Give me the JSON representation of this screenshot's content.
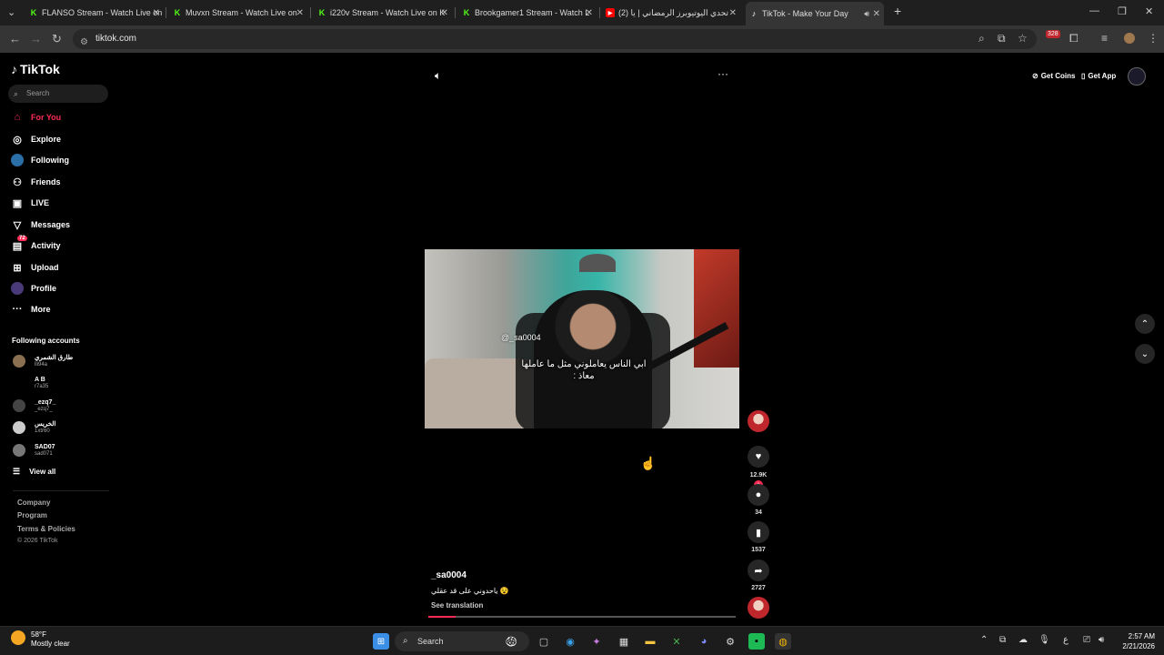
{
  "browser": {
    "tabs": [
      {
        "title": "FLANSO Stream - Watch Live on",
        "icon": "kick-icon",
        "color": "#53fc18"
      },
      {
        "title": "Muvxn Stream - Watch Live on",
        "icon": "kick-icon",
        "color": "#53fc18"
      },
      {
        "title": "i220v Stream - Watch Live on K",
        "icon": "kick-icon",
        "color": "#53fc18"
      },
      {
        "title": "Brookgamer1 Stream - Watch L",
        "icon": "kick-icon",
        "color": "#53fc18"
      },
      {
        "title": "(2) تحدي اليوتيوبرز الرمضاني | يا",
        "icon": "youtube-icon",
        "color": "#ff0000"
      },
      {
        "title": "TikTok - Make Your Day",
        "icon": "tiktok-icon",
        "color": "#ffffff"
      }
    ],
    "url": "tiktok.com",
    "extension_badge": "328"
  },
  "sidebar": {
    "logo": "TikTok",
    "search_placeholder": "Search",
    "nav": [
      {
        "label": "For You",
        "icon": "home-icon",
        "active": true
      },
      {
        "label": "Explore",
        "icon": "compass-icon"
      },
      {
        "label": "Following",
        "icon": "following-icon"
      },
      {
        "label": "Friends",
        "icon": "friends-icon"
      },
      {
        "label": "LIVE",
        "icon": "live-icon"
      },
      {
        "label": "Messages",
        "icon": "messages-icon"
      },
      {
        "label": "Activity",
        "icon": "activity-icon",
        "badge": "72"
      },
      {
        "label": "Upload",
        "icon": "upload-icon"
      },
      {
        "label": "Profile",
        "icon": "profile-icon"
      },
      {
        "label": "More",
        "icon": "more-icon"
      }
    ],
    "following_title": "Following accounts",
    "accounts": [
      {
        "name": "طارق الشمري",
        "handle": "lli94a"
      },
      {
        "name": "A B",
        "handle": "r7a35"
      },
      {
        "name": "_ezq7_",
        "handle": "_ezq7_"
      },
      {
        "name": "الخريس",
        "handle": "1xtr60"
      },
      {
        "name": "SAD07",
        "handle": "sad071"
      }
    ],
    "view_all": "View all",
    "footer": [
      "Company",
      "Program",
      "Terms & Policies"
    ],
    "copyright": "© 2026 TikTok"
  },
  "header": {
    "get_coins": "Get Coins",
    "get_app": "Get App"
  },
  "video": {
    "watermark": "@_sa0004",
    "caption_line1": "ابي الناس يعاملوني مثل ما عاملها",
    "caption_line2": "معاذ :",
    "author": "_sa0004",
    "description": "ياحدوني على قد عقلي 😵",
    "see_translation": "See translation",
    "progress": 0.09
  },
  "actions": {
    "likes": "12.9K",
    "comments": "34",
    "saves": "1537",
    "shares": "2727"
  },
  "taskbar": {
    "temp": "58°F",
    "weather": "Mostly clear",
    "search": "Search",
    "time": "2:57 AM",
    "date": "2/21/2026",
    "lang": "ع"
  }
}
